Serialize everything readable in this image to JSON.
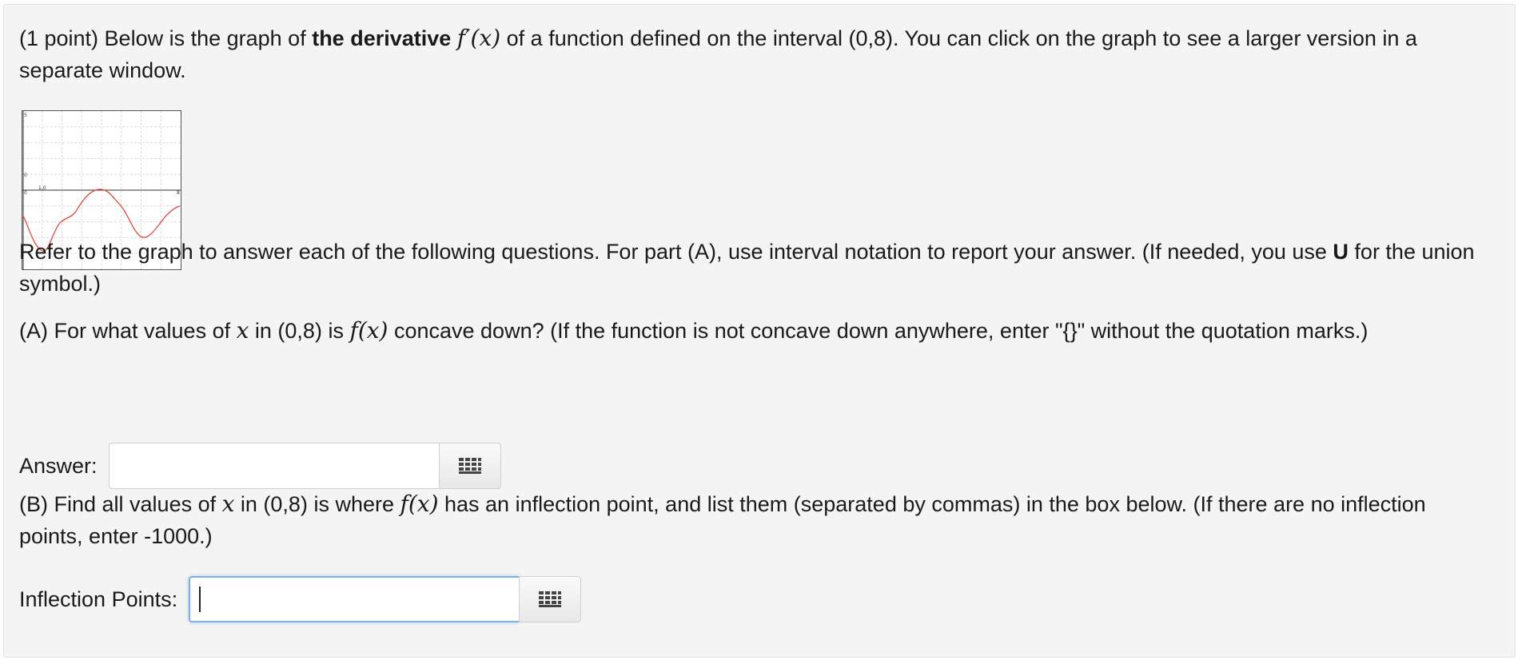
{
  "problem": {
    "intro_prefix": "(1 point) Below is the graph of ",
    "intro_bold": "the derivative",
    "intro_math": "f′(x)",
    "intro_suffix": " of a function defined on the interval (0,8). You can click on the graph to see a larger version in a separate window.",
    "refer_prefix": "Refer to the graph to answer each of the following questions. For part (A), use interval notation to report your answer. (If needed, you use ",
    "refer_bold": "U",
    "refer_suffix": " for the union symbol.)",
    "partA_prefix": "(A) For what values of ",
    "partA_var": "x",
    "partA_mid": " in (0,8) is ",
    "partA_func": "f(x)",
    "partA_suffix": " concave down? (If the function is not concave down anywhere, enter \"{}\" without the quotation marks.)",
    "partB_prefix": "(B) Find all values of ",
    "partB_var": "x",
    "partB_mid": " in (0,8) is where ",
    "partB_func": "f(x)",
    "partB_suffix": " has an inflection point, and list them (separated by commas) in the box below. (If there are no inflection points, enter -1000.)"
  },
  "graph": {
    "y_top_label": "5",
    "y_mid_label": "0",
    "origin_label": "0",
    "x_end_label": "8",
    "x_tick_label": "1,0",
    "curve_color": "#e03a2e"
  },
  "answers": {
    "a_label": "Answer:",
    "a_value": "",
    "b_label": "Inflection Points:",
    "b_value": ""
  },
  "icons": {
    "keyboard": "equation-editor-grid-icon"
  }
}
